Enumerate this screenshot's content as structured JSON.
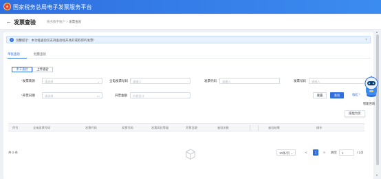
{
  "app": {
    "title": "国家税务总局电子发票服务平台"
  },
  "page": {
    "back_icon": "arrow-left-icon",
    "title": "发票查验",
    "breadcrumb": {
      "parent": "税务数字账户",
      "separator": ">",
      "current": "发票查验"
    }
  },
  "notice": {
    "icon": "info-icon",
    "text": "温馨提示：本功能查验仅支持查验经开具的或取得的发票！",
    "close": "×"
  },
  "tabs": [
    {
      "label": "单张查验",
      "active": true
    },
    {
      "label": "批量查验",
      "active": false
    }
  ],
  "modes": [
    {
      "label": "手工查验",
      "active": true
    },
    {
      "label": "上传查验",
      "active": false
    }
  ],
  "form": {
    "source": {
      "label": "发票来源",
      "placeholder": "请选择"
    },
    "fullnum": {
      "label": "全电发票号码",
      "placeholder": "请输入"
    },
    "code": {
      "label": "发票代码",
      "placeholder": "请输入"
    },
    "number": {
      "label": "发票号码",
      "placeholder": "请输入"
    },
    "date": {
      "label": "开票日期",
      "placeholder": "请选择"
    },
    "amount": {
      "label": "开票金额",
      "placeholder": "价税合计"
    }
  },
  "buttons": {
    "reset": "重置",
    "query": "查验",
    "collapse": "收起 ^"
  },
  "table": {
    "headers": [
      "序号",
      "全电发票号码",
      "发票代码",
      "发票号码",
      "发票风险等级",
      "开票日期",
      "查验次数",
      "查验结果",
      "操作"
    ],
    "total": "共 0 条"
  },
  "pager": {
    "size": "10条/页",
    "prev": "<",
    "current": "1",
    "next": ">",
    "goto_label": "跳至",
    "goto_value": "1",
    "total_pages": "/ 1页"
  },
  "assistant": {
    "label": "智能咨询",
    "tooltip": "吸住为页"
  },
  "colors": {
    "primary": "#2f6fe0",
    "header": "#3b8cf0",
    "required": "#e8423c"
  }
}
